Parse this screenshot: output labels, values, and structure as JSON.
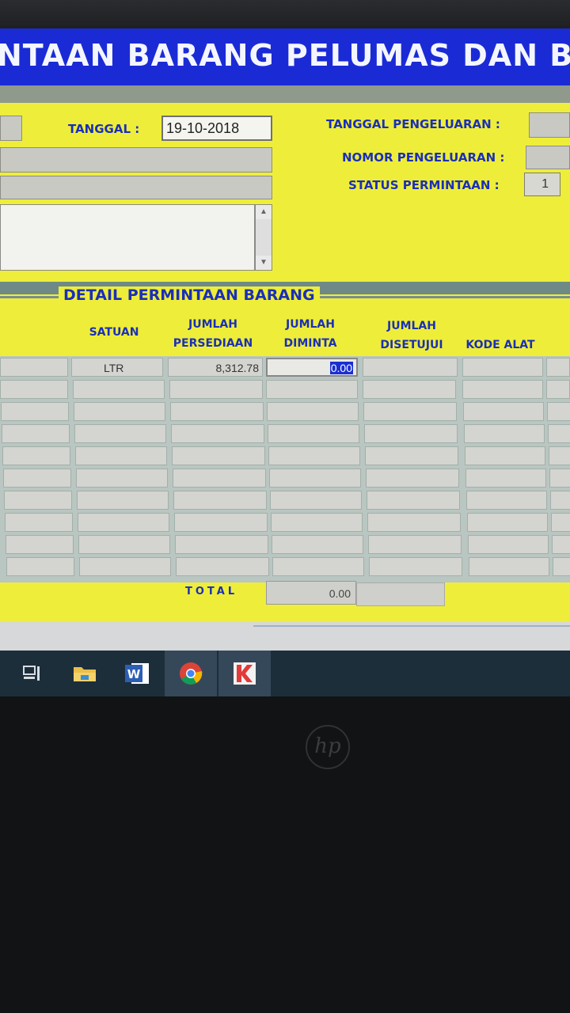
{
  "window": {
    "title": "NTAAN BARANG PELUMAS DAN BBM"
  },
  "header": {
    "tanggal_label": "TANGGAL :",
    "tanggal_value": "19-10-2018",
    "tanggal_pengeluaran_label": "TANGGAL PENGELUARAN :",
    "nomor_pengeluaran_label": "NOMOR PENGELUARAN :",
    "status_permintaan_label": "STATUS PERMINTAAN :",
    "status_permintaan_value": "1"
  },
  "detail": {
    "section_title": "DETAIL PERMINTAAN BARANG",
    "columns": {
      "satuan": "SATUAN",
      "jumlah_persediaan": [
        "JUMLAH",
        "PERSEDIAAN"
      ],
      "jumlah_diminta": [
        "JUMLAH",
        "DIMINTA"
      ],
      "jumlah_disetujui": [
        "JUMLAH",
        "DISETUJUI"
      ],
      "kode_alat": "KODE ALAT"
    },
    "rows": [
      {
        "satuan": "LTR",
        "persediaan": "8,312.78",
        "diminta": "0.00",
        "disetujui": "",
        "kode_alat": ""
      }
    ],
    "total_label": "TOTAL",
    "total_value": "0.00"
  },
  "taskbar": {
    "icons": [
      "task-view-icon",
      "file-explorer-icon",
      "word-icon",
      "chrome-icon",
      "app-k-icon"
    ]
  },
  "monitor": {
    "brand": "hp"
  },
  "colors": {
    "title_bg": "#1a2bd6",
    "panel_yellow": "#eeee3a",
    "label_blue": "#1b2fb8",
    "selection": "#1b2fd0"
  }
}
